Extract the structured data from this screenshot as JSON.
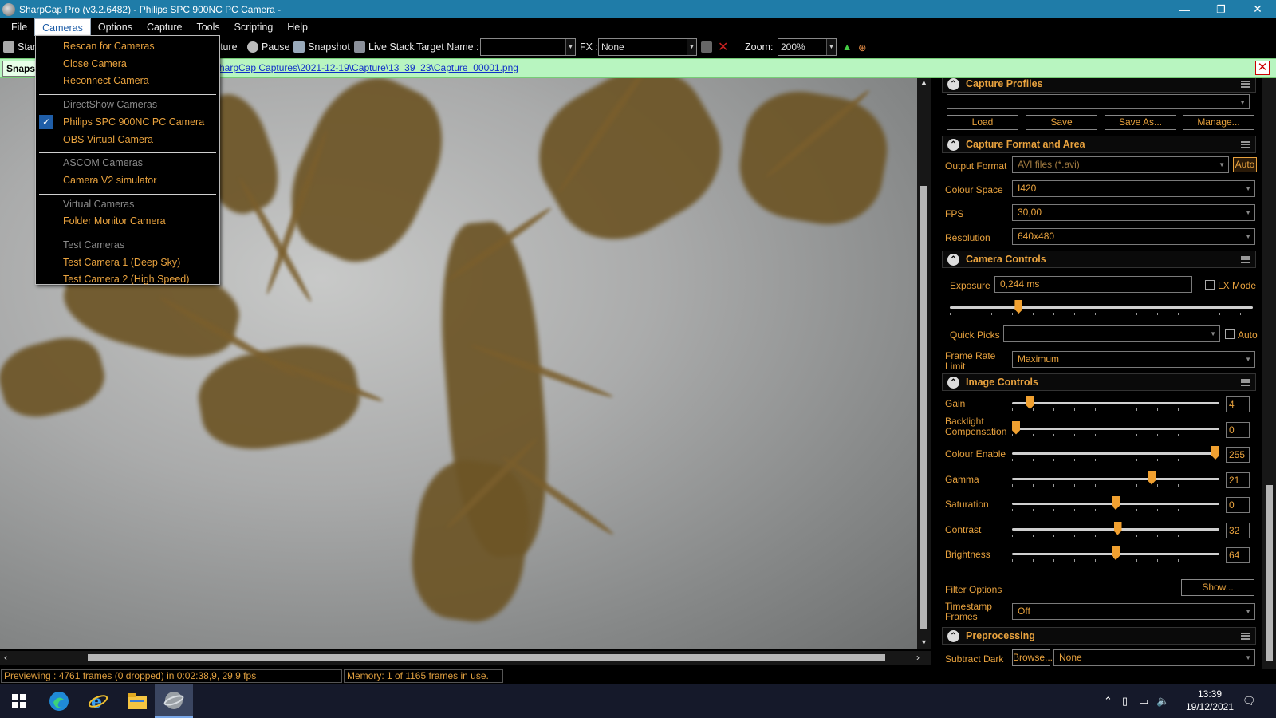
{
  "window": {
    "title": "SharpCap Pro (v3.2.6482) - Philips SPC 900NC PC Camera -",
    "controls": [
      "—",
      "❐",
      "✕"
    ]
  },
  "menubar": [
    "File",
    "Cameras",
    "Options",
    "Capture",
    "Tools",
    "Scripting",
    "Help"
  ],
  "toolbar": {
    "start": "Start",
    "capture": "ture",
    "pause": "Pause",
    "snapshot": "Snapshot",
    "live_stack": "Live Stack",
    "target_name_label": "Target Name :",
    "target_name_value": "",
    "fx_label": "FX :",
    "fx_value": "None",
    "zoom_label": "Zoom:",
    "zoom_value": "200%"
  },
  "notification": {
    "snapshot_label": "Snapsh",
    "path": "harpCap Captures\\2021-12-19\\Capture\\13_39_23\\Capture_00001.png",
    "close": "✕"
  },
  "cameras_menu": {
    "items": [
      {
        "label": "Rescan for Cameras",
        "type": "item"
      },
      {
        "label": "Close Camera",
        "type": "item"
      },
      {
        "label": "Reconnect Camera",
        "type": "item"
      },
      {
        "label": "DirectShow Cameras",
        "type": "header"
      },
      {
        "label": "Philips SPC 900NC PC Camera",
        "type": "item",
        "checked": true
      },
      {
        "label": "OBS Virtual Camera",
        "type": "item"
      },
      {
        "label": "ASCOM Cameras",
        "type": "header"
      },
      {
        "label": "Camera V2 simulator",
        "type": "item"
      },
      {
        "label": "Virtual Cameras",
        "type": "header"
      },
      {
        "label": "Folder Monitor Camera",
        "type": "item"
      },
      {
        "label": "Test Cameras",
        "type": "header"
      },
      {
        "label": "Test Camera 1 (Deep Sky)",
        "type": "item"
      },
      {
        "label": "Test Camera 2 (High Speed)",
        "type": "item"
      }
    ]
  },
  "panel": {
    "capture_profiles": {
      "title": "Capture Profiles",
      "profile_value": "",
      "buttons": [
        "Load",
        "Save",
        "Save As...",
        "Manage..."
      ]
    },
    "capture_format": {
      "title": "Capture Format and Area",
      "output_format_label": "Output Format",
      "output_format_value": "AVI files (*.avi)",
      "auto_button": "Auto",
      "colour_space_label": "Colour Space",
      "colour_space_value": "I420",
      "fps_label": "FPS",
      "fps_value": "30,00",
      "resolution_label": "Resolution",
      "resolution_value": "640x480"
    },
    "camera_controls": {
      "title": "Camera Controls",
      "exposure_label": "Exposure",
      "exposure_value": "0,244 ms",
      "exposure_slider": 0.22,
      "lx_mode_label": "LX Mode",
      "quick_picks_label": "Quick Picks",
      "quick_picks_value": "",
      "auto_label": "Auto",
      "frame_rate_label": "Frame Rate Limit",
      "frame_rate_value": "Maximum"
    },
    "image_controls": {
      "title": "Image Controls",
      "sliders": [
        {
          "label": "Gain",
          "value": "4",
          "fraction": 0.07
        },
        {
          "label": "Backlight Compensation",
          "value": "0",
          "fraction": 0.0
        },
        {
          "label": "Colour Enable",
          "value": "255",
          "fraction": 1.0
        },
        {
          "label": "Gamma",
          "value": "21",
          "fraction": 0.68
        },
        {
          "label": "Saturation",
          "value": "0",
          "fraction": 0.5
        },
        {
          "label": "Contrast",
          "value": "32",
          "fraction": 0.51
        },
        {
          "label": "Brightness",
          "value": "64",
          "fraction": 0.5
        }
      ],
      "filter_options_label": "Filter Options",
      "filter_options_button": "Show...",
      "timestamp_label": "Timestamp Frames",
      "timestamp_value": "Off"
    },
    "preprocessing": {
      "title": "Preprocessing",
      "subtract_dark_label": "Subtract Dark",
      "browse_button": "Browse...",
      "subtract_dark_value": "None"
    }
  },
  "statusbar": {
    "preview": "Previewing : 4761 frames (0 dropped) in 0:02:38,9, 29,9 fps",
    "memory": "Memory: 1 of 1165 frames in use."
  },
  "taskbar": {
    "time": "13:39",
    "date": "19/12/2021",
    "apps": [
      "start-icon",
      "edge-icon",
      "ie-icon",
      "explorer-icon",
      "sharpcap-icon"
    ]
  },
  "colors": {
    "accent": "#e8a23e",
    "titlebar": "#1f7ca8",
    "notification": "#b8f5c0"
  }
}
